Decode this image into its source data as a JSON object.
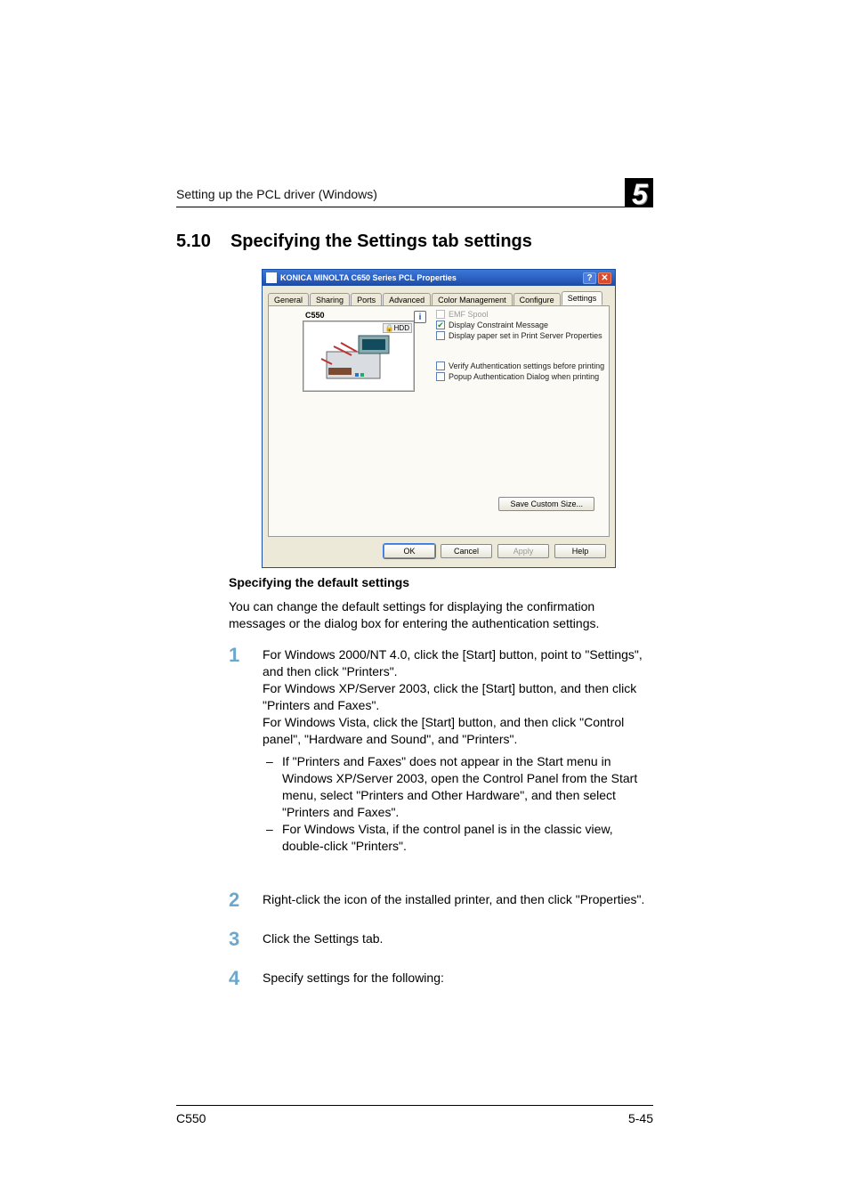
{
  "header": {
    "section_name": "Setting up the PCL driver (Windows)",
    "chapter_number": "5"
  },
  "section": {
    "number": "5.10",
    "title": "Specifying the Settings tab settings"
  },
  "dialog": {
    "title": "KONICA MINOLTA C650 Series PCL Properties",
    "help_btn": "?",
    "close_btn": "✕",
    "tabs": [
      "General",
      "Sharing",
      "Ports",
      "Advanced",
      "Color Management",
      "Configure",
      "Settings"
    ],
    "active_tab_index": 6,
    "preview_label": "C550",
    "preview_hdd": "HDD",
    "info_btn": "i",
    "opts": {
      "emf": {
        "label": "EMF Spool",
        "checked": false,
        "disabled": true
      },
      "constraint": {
        "label": "Display Constraint Message",
        "checked": true
      },
      "paperset": {
        "label": "Display paper set in Print Server Properties",
        "checked": false
      },
      "verify": {
        "label": "Verify Authentication settings before printing",
        "checked": false
      },
      "popup": {
        "label": "Popup Authentication Dialog when printing",
        "checked": false
      }
    },
    "save_custom": "Save Custom Size...",
    "buttons": {
      "ok": "OK",
      "cancel": "Cancel",
      "apply": "Apply",
      "help": "Help"
    }
  },
  "body": {
    "subhead": "Specifying the default settings",
    "intro": "You can change the default settings for displaying the confirmation messages or the dialog box for entering the authentication settings.",
    "steps": {
      "s1_a": "For Windows 2000/NT 4.0, click the [Start] button, point to \"Settings\", and then click \"Printers\".",
      "s1_b": "For Windows XP/Server 2003, click the [Start] button, and then click \"Printers and Faxes\".",
      "s1_c": "For Windows Vista, click the [Start] button, and then click \"Control panel\", \"Hardware and Sound\", and \"Printers\".",
      "s1_sub1": "If \"Printers and Faxes\" does not appear in the Start menu in Windows XP/Server 2003, open the Control Panel from the Start menu, select \"Printers and Other Hardware\", and then select \"Printers and Faxes\".",
      "s1_sub2": "For Windows Vista, if the control panel is in the classic view, double-click \"Printers\".",
      "s2": "Right-click the icon of the installed printer, and then click \"Properties\".",
      "s3": "Click the Settings tab.",
      "s4": "Specify settings for the following:"
    },
    "nums": {
      "n1": "1",
      "n2": "2",
      "n3": "3",
      "n4": "4"
    }
  },
  "footer": {
    "left": "C550",
    "right": "5-45"
  }
}
